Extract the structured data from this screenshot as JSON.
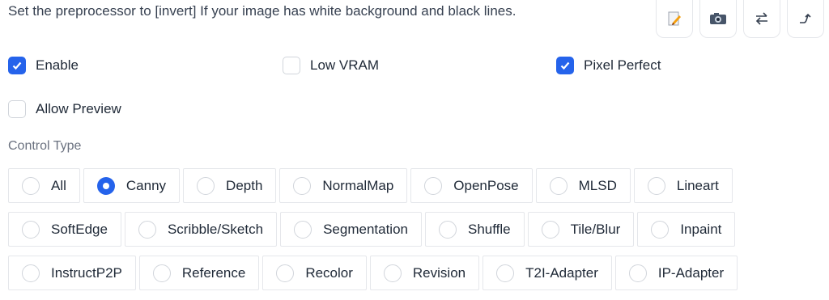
{
  "hint_text": "Set the preprocessor to [invert] If your image has white background and black lines.",
  "toolbar": [
    {
      "icon": "edit-icon"
    },
    {
      "icon": "camera-icon"
    },
    {
      "icon": "swap-arrows-icon"
    },
    {
      "icon": "send-arrow-icon"
    }
  ],
  "checkboxes": {
    "enable": {
      "label": "Enable",
      "checked": true
    },
    "low_vram": {
      "label": "Low VRAM",
      "checked": false
    },
    "pixel_perfect": {
      "label": "Pixel Perfect",
      "checked": true
    },
    "allow_preview": {
      "label": "Allow Preview",
      "checked": false
    }
  },
  "control_type": {
    "label": "Control Type",
    "selected": "Canny",
    "rows": [
      [
        "All",
        "Canny",
        "Depth",
        "NormalMap",
        "OpenPose",
        "MLSD",
        "Lineart"
      ],
      [
        "SoftEdge",
        "Scribble/Sketch",
        "Segmentation",
        "Shuffle",
        "Tile/Blur",
        "Inpaint"
      ],
      [
        "InstructP2P",
        "Reference",
        "Recolor",
        "Revision",
        "T2I-Adapter",
        "IP-Adapter"
      ]
    ]
  },
  "colors": {
    "accent": "#2563eb",
    "border": "#e5e7eb"
  }
}
